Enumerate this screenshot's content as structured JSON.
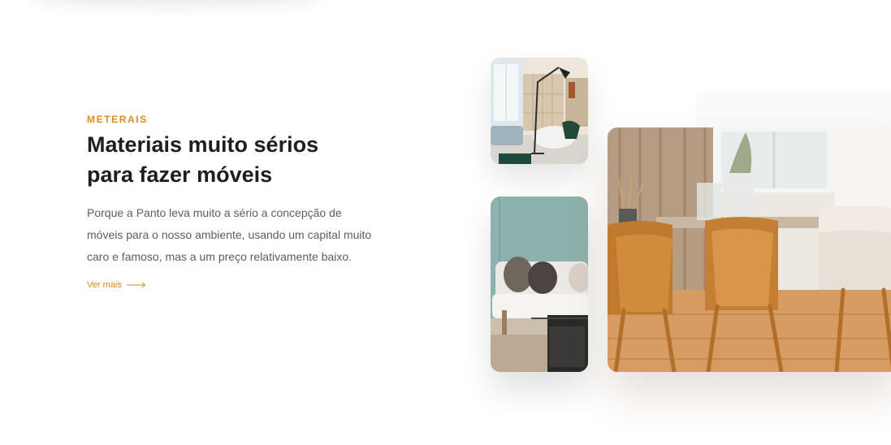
{
  "section": {
    "eyebrow": "METERAIS",
    "heading": "Materiais muito sérios para fazer móveis",
    "body": "Porque a Panto leva muito a sério a concepção de móveis para o nosso ambiente, usando um capital muito caro e famoso, mas a um preço relativamente baixo.",
    "link_label": "Ver mais",
    "link_icon": "arrow-right-icon"
  },
  "gallery": {
    "images": [
      {
        "name": "floor-lamp-living-room-photo"
      },
      {
        "name": "sofa-with-cushions-photo"
      },
      {
        "name": "dining-table-chairs-photo"
      }
    ]
  },
  "colors": {
    "accent": "#e08a1e",
    "heading": "#1e1e1e",
    "body": "#5d5d5d"
  }
}
